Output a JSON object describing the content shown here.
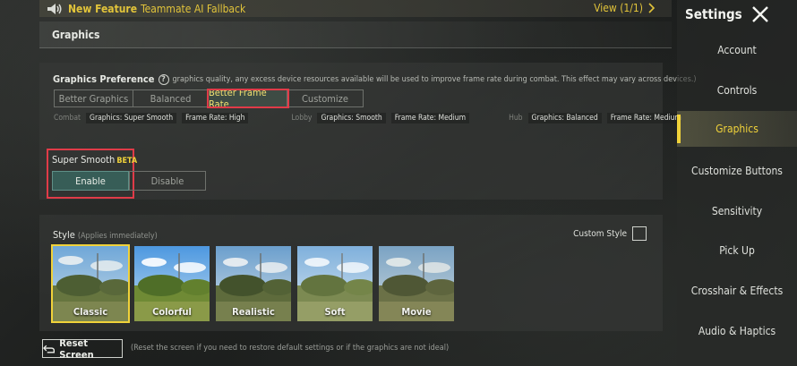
{
  "notice": {
    "feature_label": "New Feature",
    "text": "Teammate AI Fallback",
    "view_label": "View (1/1)",
    "speaker_icon": "speaker-icon",
    "arrow_icon": "chevron-right-icon"
  },
  "header": {
    "title": "Graphics"
  },
  "preference": {
    "label": "Graphics Preference",
    "description": "graphics quality, any excess device resources available will be used to improve frame rate during combat. This effect may vary across devices.)",
    "options": [
      {
        "label": "Better Graphics"
      },
      {
        "label": "Balanced"
      },
      {
        "label": "Better Frame Rate"
      },
      {
        "label": "Customize"
      }
    ],
    "selected": "Better Frame Rate",
    "stats": [
      {
        "category": "Combat",
        "graphics": "Graphics: Super Smooth",
        "frame_rate": "Frame Rate: High"
      },
      {
        "category": "Lobby",
        "graphics": "Graphics: Smooth",
        "frame_rate": "Frame Rate: Medium"
      },
      {
        "category": "Hub",
        "graphics": "Graphics: Balanced",
        "frame_rate": "Frame Rate: Medium"
      }
    ]
  },
  "super_smooth": {
    "label": "Super Smooth",
    "badge": "BETA",
    "enable_label": "Enable",
    "disable_label": "Disable",
    "selected": "Enable"
  },
  "style": {
    "label": "Style",
    "note": "(Applies immediately)",
    "custom_label": "Custom Style",
    "custom_checked": false,
    "options": [
      {
        "label": "Classic"
      },
      {
        "label": "Colorful"
      },
      {
        "label": "Realistic"
      },
      {
        "label": "Soft"
      },
      {
        "label": "Movie"
      }
    ],
    "selected": "Classic"
  },
  "reset": {
    "label": "Reset Screen",
    "note": "(Reset the screen if you need to restore default settings or if the graphics are not ideal)"
  },
  "sidebar": {
    "title": "Settings",
    "items": [
      {
        "label": "Account"
      },
      {
        "label": "Controls"
      },
      {
        "label": "Graphics"
      },
      {
        "label": "Customize Buttons"
      },
      {
        "label": "Sensitivity"
      },
      {
        "label": "Pick Up"
      },
      {
        "label": "Crosshair & Effects"
      },
      {
        "label": "Audio & Haptics"
      }
    ],
    "selected": "Graphics"
  },
  "colors": {
    "accent_yellow": "#f0d23a",
    "highlight_red": "#e03b48",
    "enable_green": "#375d57"
  }
}
